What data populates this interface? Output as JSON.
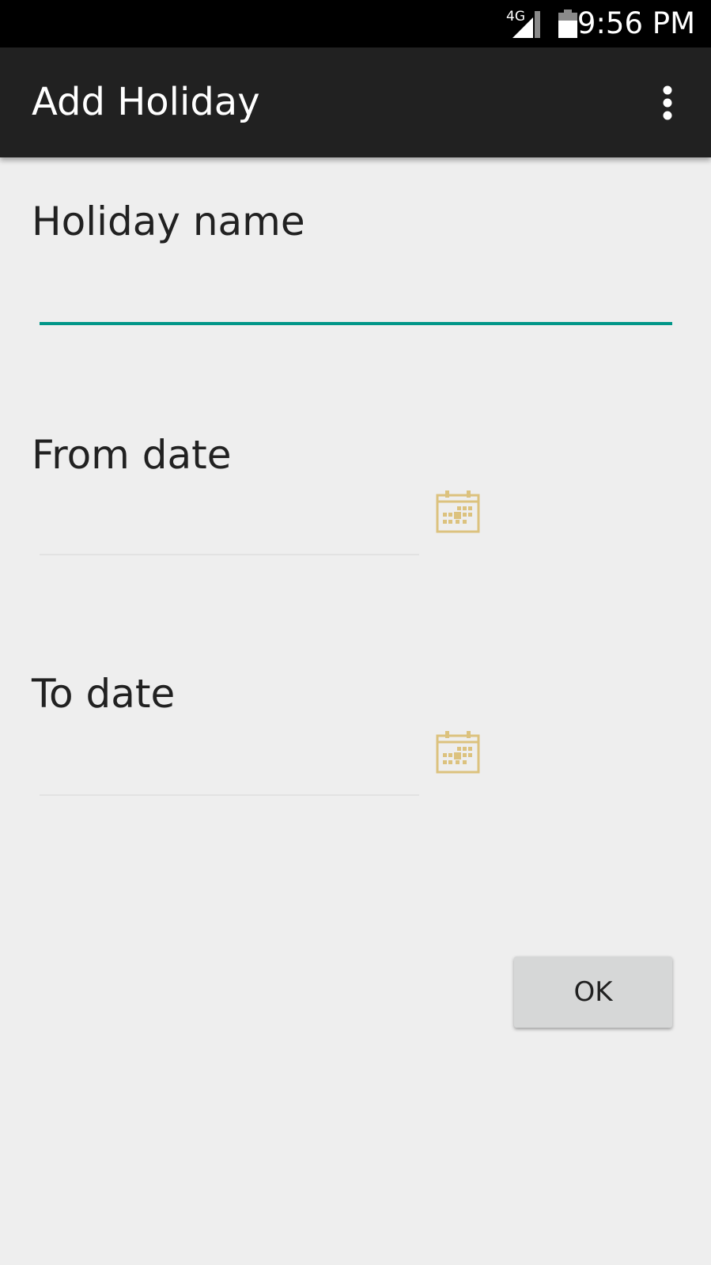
{
  "status_bar": {
    "network": "4G",
    "time": "9:56 PM",
    "icons": [
      "signal-icon",
      "battery-icon"
    ]
  },
  "toolbar": {
    "title": "Add Holiday",
    "menu_icon": "overflow-menu-icon"
  },
  "form": {
    "holiday_name": {
      "label": "Holiday name",
      "value": "",
      "placeholder": ""
    },
    "from_date": {
      "label": "From date",
      "value": "",
      "placeholder": "",
      "icon": "calendar-icon"
    },
    "to_date": {
      "label": "To date",
      "value": "",
      "placeholder": "",
      "icon": "calendar-icon"
    },
    "ok_label": "OK"
  },
  "colors": {
    "status_bar": "#000000",
    "toolbar": "#212121",
    "background": "#eeeeee",
    "accent_underline": "#009688",
    "calendar_icon": "#dcc27e",
    "button": "#d6d7d7"
  }
}
